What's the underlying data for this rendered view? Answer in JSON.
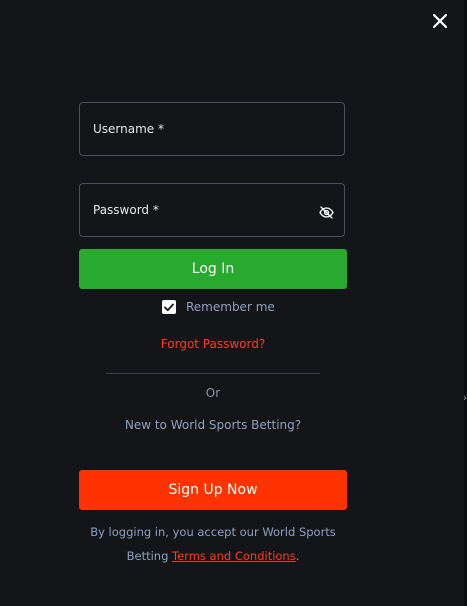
{
  "dialog": {
    "close_icon": "close-icon",
    "edge_chevron": "›"
  },
  "form": {
    "username_label": "Username *",
    "password_label": "Password *",
    "password_toggle_icon": "eye-slash-icon",
    "login_label": "Log In",
    "remember_label": "Remember me",
    "remember_checked": true,
    "forgot_label": "Forgot Password?",
    "or_label": "Or",
    "new_to_label": "New to World Sports Betting?",
    "signup_label": "Sign Up Now",
    "terms_prefix": "By logging in, you accept our World Sports Betting ",
    "terms_link": "Terms and Conditions",
    "terms_suffix": "."
  },
  "colors": {
    "background": "#141519",
    "login_button": "#27aa2e",
    "signup_button": "#ff3300",
    "accent_link": "#ff3b1f",
    "muted_text": "#8fa0c0"
  }
}
